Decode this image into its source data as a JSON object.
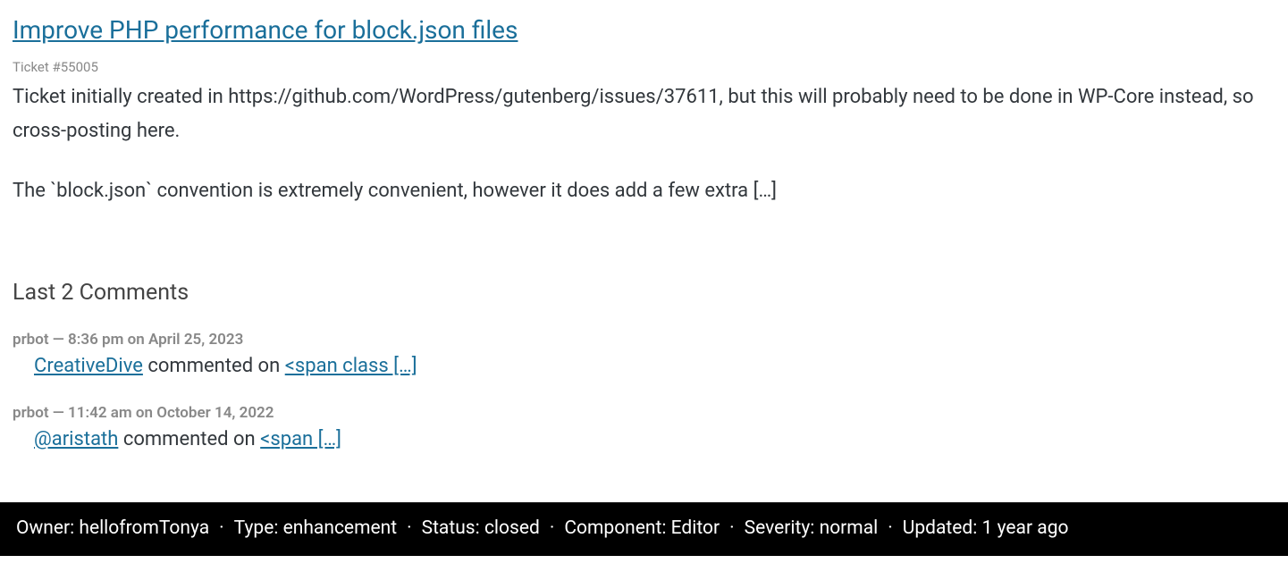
{
  "ticket": {
    "title": "Improve PHP performance for block.json files",
    "meta": "Ticket #55005",
    "description_p1": "Ticket initially created in https://github.com/WordPress/gutenberg/issues/37611, but this will probably need to be done in WP-Core instead, so cross-posting here.",
    "description_p2": "The `block.json` convention is extremely convenient, however it does add a few extra […]"
  },
  "comments": {
    "heading": "Last 2 Comments",
    "items": [
      {
        "meta": "prbot — 8:36 pm on April 25, 2023",
        "author_link": "CreativeDive",
        "mid": " commented on ",
        "trail_link": "<span class […]"
      },
      {
        "meta": "prbot — 11:42 am on October 14, 2022",
        "author_link": "@aristath",
        "mid": " commented on ",
        "trail_link": "<span […]"
      }
    ]
  },
  "footer": {
    "owner_label": "Owner: ",
    "owner_value": "hellofromTonya",
    "type_label": "Type: ",
    "type_value": "enhancement",
    "status_label": "Status: ",
    "status_value": "closed",
    "component_label": "Component: ",
    "component_value": "Editor",
    "severity_label": "Severity: ",
    "severity_value": "normal",
    "updated_label": "Updated: ",
    "updated_value": "1 year ago",
    "sep": "·"
  }
}
